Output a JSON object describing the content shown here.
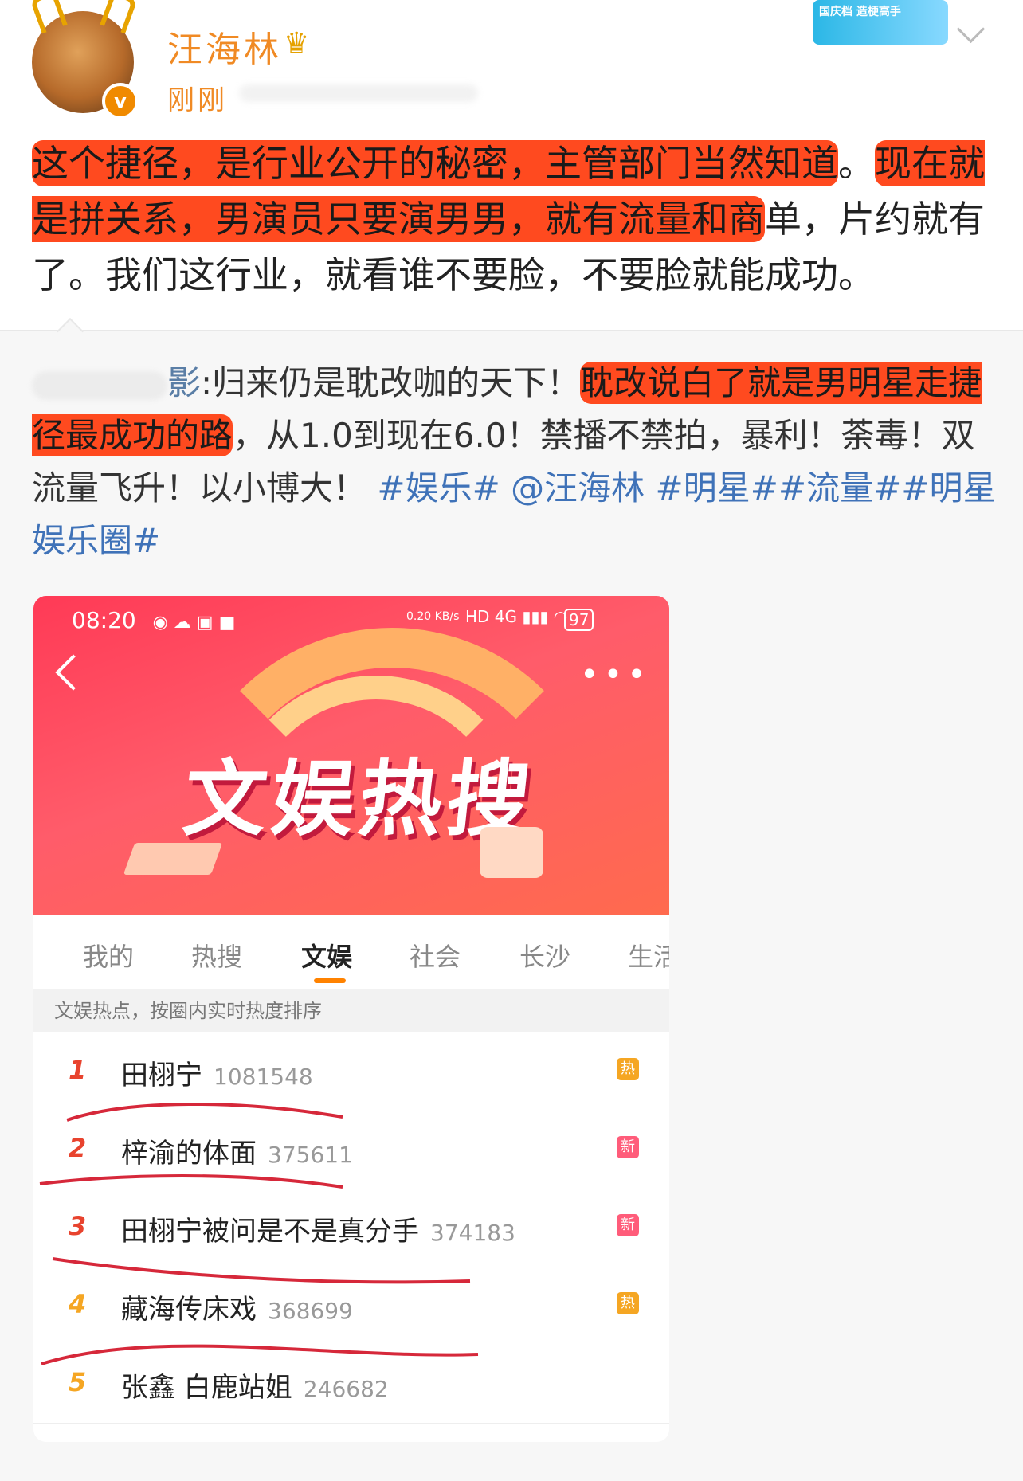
{
  "header": {
    "username": "汪海林",
    "time": "刚刚",
    "verified_badge": "v",
    "decor_text": "国庆档 造梗高手"
  },
  "post": {
    "seg1": "这个捷径，是行业公开的秘密，主管部门当然知道",
    "seg2": "。",
    "seg3": "现在就是拼关系，男演员只要演男男，就有流量和商",
    "seg4": "单，片约就有了。我们这行业，就看谁不要脸，不要脸就能成功。"
  },
  "repost": {
    "author_tail": "影",
    "seg1": ":归来仍是耽改咖的天下！",
    "seg2": "耽改说白了就是男明星走捷径最成功的路",
    "seg3": "，从1.0到现在6.0！禁播不禁拍，暴利！荼毒！双流量飞升！以小博大！",
    "tags": [
      "#娱乐#",
      "@汪海林",
      "#明星##流量##明星娱乐圈#"
    ]
  },
  "screenshot": {
    "status_time": "08:20",
    "status_battery": "97",
    "status_net": "0.20 KB/s",
    "banner_title": "文娱热搜",
    "tabs": [
      "我的",
      "热搜",
      "文娱",
      "社会",
      "长沙",
      "生活"
    ],
    "active_tab": "文娱",
    "subheader": "文娱热点，按圈内实时热度排序",
    "rows": [
      {
        "rank": "1",
        "title": "田栩宁",
        "num": "1081548",
        "badge": "热",
        "rank_color": "#e8432e",
        "badge_color": "#f5a623"
      },
      {
        "rank": "2",
        "title": "梓渝的体面",
        "num": "375611",
        "badge": "新",
        "rank_color": "#e8432e",
        "badge_color": "#ff5c7a"
      },
      {
        "rank": "3",
        "title": "田栩宁被问是不是真分手",
        "num": "374183",
        "badge": "新",
        "rank_color": "#e8432e",
        "badge_color": "#ff5c7a"
      },
      {
        "rank": "4",
        "title": "藏海传床戏",
        "num": "368699",
        "badge": "热",
        "rank_color": "#f5a623",
        "badge_color": "#f5a623"
      },
      {
        "rank": "5",
        "title": "张鑫 白鹿站姐",
        "num": "246682",
        "badge": "",
        "rank_color": "#f5a623",
        "badge_color": ""
      }
    ]
  },
  "colors": {
    "accent": "#f08a24",
    "highlight": "#ff4a1f",
    "link": "#3f72b8",
    "scribble": "#d6283a"
  }
}
